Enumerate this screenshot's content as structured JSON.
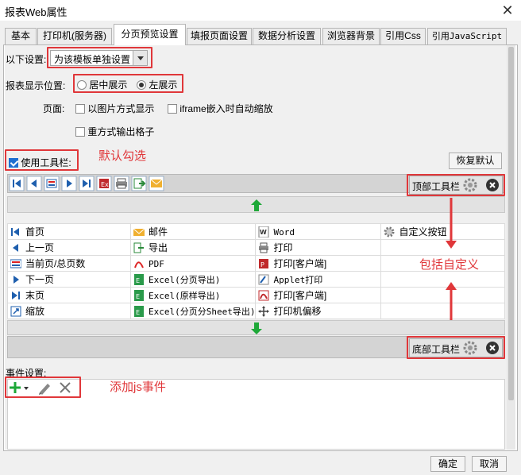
{
  "window": {
    "title": "报表Web属性",
    "close_label": "✕"
  },
  "tabs": [
    {
      "label": "基本"
    },
    {
      "label": "打印机(服务器)"
    },
    {
      "label": "分页预览设置",
      "active": true
    },
    {
      "label": "填报页面设置"
    },
    {
      "label": "数据分析设置"
    },
    {
      "label": "浏览器背景"
    },
    {
      "label": "引用Css"
    },
    {
      "label": "引用JavaScript"
    }
  ],
  "settings": {
    "label": "以下设置:",
    "select_value": "为该模板单独设置"
  },
  "position": {
    "label": "报表显示位置:",
    "opt_center": "居中展示",
    "opt_left": "左展示",
    "selected": "left"
  },
  "page": {
    "label": "页面:",
    "image_mode": "以图片方式显示",
    "iframe_zoom": "iframe嵌入时自动缩放",
    "repeat_cells": "重方式输出格子"
  },
  "toolbar": {
    "use_label": "使用工具栏:",
    "restore_btn": "恢复默认",
    "top_label": "顶部工具栏",
    "bottom_label": "底部工具栏"
  },
  "annotations": {
    "default_checked": "默认勾选",
    "custom": "包括自定义",
    "add_js": "添加js事件"
  },
  "grid": [
    [
      "首页",
      "邮件",
      "Word",
      "自定义按钮"
    ],
    [
      "上一页",
      "导出",
      "打印",
      ""
    ],
    [
      "当前页/总页数",
      "PDF",
      "打印[客户端]",
      ""
    ],
    [
      "下一页",
      "Excel(分页导出)",
      "Applet打印",
      ""
    ],
    [
      "末页",
      "Excel(原样导出)",
      "打印[客户端]",
      ""
    ],
    [
      "缩放",
      "Excel(分页分Sheet导出)",
      "打印机偏移",
      ""
    ]
  ],
  "events": {
    "label": "事件设置:"
  },
  "footer": {
    "ok": "确定",
    "cancel": "取消"
  },
  "colors": {
    "accent": "#1e6fd1",
    "highlight": "#e0373a",
    "green": "#1ea838"
  }
}
